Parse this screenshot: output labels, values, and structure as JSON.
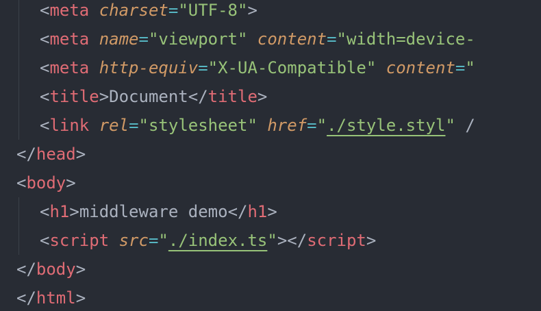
{
  "editor": {
    "language": "html",
    "colors": {
      "background": "#282c34",
      "punctuation": "#abb2bf",
      "tag": "#e06c75",
      "attribute": "#d19a66",
      "operator": "#56b6c2",
      "string": "#98c379",
      "text": "#abb2bf"
    },
    "lines": [
      {
        "indent": 1,
        "tokens": [
          {
            "t": "punct",
            "v": "<"
          },
          {
            "t": "tag",
            "v": "meta"
          },
          {
            "t": "punct",
            "v": " "
          },
          {
            "t": "attr",
            "v": "charset"
          },
          {
            "t": "eq",
            "v": "="
          },
          {
            "t": "str",
            "v": "\"UTF-8\""
          },
          {
            "t": "punct",
            "v": ">"
          }
        ]
      },
      {
        "indent": 1,
        "tokens": [
          {
            "t": "punct",
            "v": "<"
          },
          {
            "t": "tag",
            "v": "meta"
          },
          {
            "t": "punct",
            "v": " "
          },
          {
            "t": "attr",
            "v": "name"
          },
          {
            "t": "eq",
            "v": "="
          },
          {
            "t": "str",
            "v": "\"viewport\""
          },
          {
            "t": "punct",
            "v": " "
          },
          {
            "t": "attr",
            "v": "content"
          },
          {
            "t": "eq",
            "v": "="
          },
          {
            "t": "str",
            "v": "\"width=device-"
          }
        ]
      },
      {
        "indent": 1,
        "tokens": [
          {
            "t": "punct",
            "v": "<"
          },
          {
            "t": "tag",
            "v": "meta"
          },
          {
            "t": "punct",
            "v": " "
          },
          {
            "t": "attr",
            "v": "http-equiv"
          },
          {
            "t": "eq",
            "v": "="
          },
          {
            "t": "str",
            "v": "\"X-UA-Compatible\""
          },
          {
            "t": "punct",
            "v": " "
          },
          {
            "t": "attr",
            "v": "content"
          },
          {
            "t": "eq",
            "v": "="
          },
          {
            "t": "str",
            "v": "\""
          }
        ]
      },
      {
        "indent": 1,
        "tokens": [
          {
            "t": "punct",
            "v": "<"
          },
          {
            "t": "tag",
            "v": "title"
          },
          {
            "t": "punct",
            "v": ">"
          },
          {
            "t": "text",
            "v": "Document"
          },
          {
            "t": "punct",
            "v": "</"
          },
          {
            "t": "tag",
            "v": "title"
          },
          {
            "t": "punct",
            "v": ">"
          }
        ]
      },
      {
        "indent": 1,
        "tokens": [
          {
            "t": "punct",
            "v": "<"
          },
          {
            "t": "tag",
            "v": "link"
          },
          {
            "t": "punct",
            "v": " "
          },
          {
            "t": "attr",
            "v": "rel"
          },
          {
            "t": "eq",
            "v": "="
          },
          {
            "t": "str",
            "v": "\"stylesheet\""
          },
          {
            "t": "punct",
            "v": " "
          },
          {
            "t": "attr",
            "v": "href"
          },
          {
            "t": "eq",
            "v": "="
          },
          {
            "t": "str",
            "v": "\""
          },
          {
            "t": "link",
            "v": "./style.styl"
          },
          {
            "t": "str",
            "v": "\""
          },
          {
            "t": "punct",
            "v": " /"
          }
        ]
      },
      {
        "indent": 0,
        "tokens": [
          {
            "t": "punct",
            "v": "</"
          },
          {
            "t": "tag",
            "v": "head"
          },
          {
            "t": "punct",
            "v": ">"
          }
        ]
      },
      {
        "indent": 0,
        "tokens": [
          {
            "t": "punct",
            "v": "<"
          },
          {
            "t": "tag",
            "v": "body"
          },
          {
            "t": "punct",
            "v": ">"
          }
        ]
      },
      {
        "indent": 1,
        "tokens": [
          {
            "t": "punct",
            "v": "<"
          },
          {
            "t": "tag",
            "v": "h1"
          },
          {
            "t": "punct",
            "v": ">"
          },
          {
            "t": "text",
            "v": "middleware demo"
          },
          {
            "t": "punct",
            "v": "</"
          },
          {
            "t": "tag",
            "v": "h1"
          },
          {
            "t": "punct",
            "v": ">"
          }
        ]
      },
      {
        "indent": 1,
        "tokens": [
          {
            "t": "punct",
            "v": "<"
          },
          {
            "t": "tag",
            "v": "script"
          },
          {
            "t": "punct",
            "v": " "
          },
          {
            "t": "attr",
            "v": "src"
          },
          {
            "t": "eq",
            "v": "="
          },
          {
            "t": "str",
            "v": "\""
          },
          {
            "t": "link",
            "v": "./index.ts"
          },
          {
            "t": "str",
            "v": "\""
          },
          {
            "t": "punct",
            "v": "></"
          },
          {
            "t": "tag",
            "v": "script"
          },
          {
            "t": "punct",
            "v": ">"
          }
        ]
      },
      {
        "indent": 0,
        "tokens": [
          {
            "t": "punct",
            "v": "</"
          },
          {
            "t": "tag",
            "v": "body"
          },
          {
            "t": "punct",
            "v": ">"
          }
        ]
      },
      {
        "indent": 0,
        "tokens": [
          {
            "t": "punct",
            "v": "</"
          },
          {
            "t": "tag",
            "v": "html"
          },
          {
            "t": "punct",
            "v": ">"
          }
        ]
      }
    ]
  }
}
